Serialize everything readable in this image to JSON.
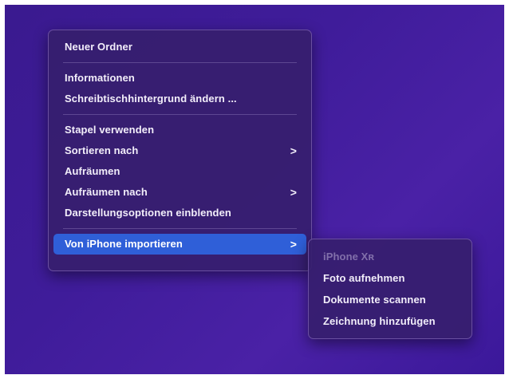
{
  "context_menu": {
    "items": [
      {
        "label": "Neuer Ordner"
      },
      {
        "label": "Informationen"
      },
      {
        "label": "Schreibtischhintergrund ändern ..."
      },
      {
        "label": "Stapel verwenden"
      },
      {
        "label": "Sortieren nach",
        "submenu_arrow": ">"
      },
      {
        "label": "Aufräumen"
      },
      {
        "label": "Aufräumen nach",
        "submenu_arrow": ">"
      },
      {
        "label": "Darstellungsoptionen einblenden"
      },
      {
        "label": "Von iPhone importieren",
        "submenu_arrow": ">",
        "selected": true
      }
    ]
  },
  "submenu": {
    "device_label": "iPhone Xʀ",
    "items": [
      {
        "label": "Foto aufnehmen"
      },
      {
        "label": "Dokumente scannen"
      },
      {
        "label": "Zeichnung hinzufügen"
      }
    ]
  },
  "colors": {
    "desktop_bg": "#3f1c9a",
    "selection": "#2f5fd8"
  }
}
